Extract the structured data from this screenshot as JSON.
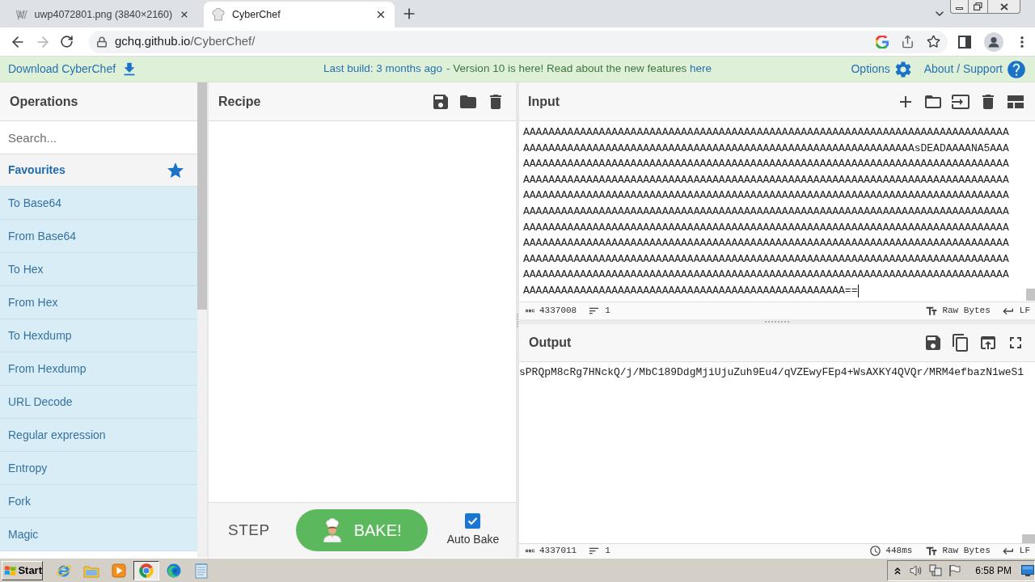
{
  "browser": {
    "tabs": [
      {
        "title": "uwp4072801.png (3840×2160)",
        "kind": "image",
        "selected": false
      },
      {
        "title": "CyberChef",
        "kind": "site",
        "selected": true
      }
    ],
    "url": {
      "host": "gchq.github.io",
      "path": "/CyberChef/"
    }
  },
  "banner": {
    "download": "Download CyberChef",
    "build": "Last build: 3 months ago",
    "notice": "- Version 10 is here! Read about the new features",
    "notice_link": "here",
    "options": "Options",
    "about": "About / Support"
  },
  "operations": {
    "title": "Operations",
    "search": {
      "placeholder": "Search..."
    },
    "favourites": "Favourites",
    "items": [
      "To Base64",
      "From Base64",
      "To Hex",
      "From Hex",
      "To Hexdump",
      "From Hexdump",
      "URL Decode",
      "Regular expression",
      "Entropy",
      "Fork",
      "Magic"
    ]
  },
  "recipe": {
    "title": "Recipe",
    "step": "STEP",
    "bake": "BAKE!",
    "auto_bake": {
      "label": "Auto Bake",
      "checked": true
    }
  },
  "input": {
    "title": "Input",
    "lines": [
      "AAAAAAAAAAAAAAAAAAAAAAAAAAAAAAAAAAAAAAAAAAAAAAAAAAAAAAAAAAAAAAAAAAAAAAAAAAAAA",
      "AAAAAAAAAAAAAAAAAAAAAAAAAAAAAAAAAAAAAAAAAAAAAAAAAAAAAAAAAAAAAAsDEADAAAANA5AAA",
      "AAAAAAAAAAAAAAAAAAAAAAAAAAAAAAAAAAAAAAAAAAAAAAAAAAAAAAAAAAAAAAAAAAAAAAAAAAAAA",
      "AAAAAAAAAAAAAAAAAAAAAAAAAAAAAAAAAAAAAAAAAAAAAAAAAAAAAAAAAAAAAAAAAAAAAAAAAAAAA",
      "AAAAAAAAAAAAAAAAAAAAAAAAAAAAAAAAAAAAAAAAAAAAAAAAAAAAAAAAAAAAAAAAAAAAAAAAAAAAA",
      "AAAAAAAAAAAAAAAAAAAAAAAAAAAAAAAAAAAAAAAAAAAAAAAAAAAAAAAAAAAAAAAAAAAAAAAAAAAAA",
      "AAAAAAAAAAAAAAAAAAAAAAAAAAAAAAAAAAAAAAAAAAAAAAAAAAAAAAAAAAAAAAAAAAAAAAAAAAAAA",
      "AAAAAAAAAAAAAAAAAAAAAAAAAAAAAAAAAAAAAAAAAAAAAAAAAAAAAAAAAAAAAAAAAAAAAAAAAAAAA",
      "AAAAAAAAAAAAAAAAAAAAAAAAAAAAAAAAAAAAAAAAAAAAAAAAAAAAAAAAAAAAAAAAAAAAAAAAAAAAA",
      "AAAAAAAAAAAAAAAAAAAAAAAAAAAAAAAAAAAAAAAAAAAAAAAAAAAAAAAAAAAAAAAAAAAAAAAAAAAAA",
      "AAAAAAAAAAAAAAAAAAAAAAAAAAAAAAAAAAAAAAAAAAAAAAAAAAA=="
    ],
    "status": {
      "length": "4337008",
      "lines": "1",
      "format": "Raw Bytes",
      "eol": "LF"
    }
  },
  "output": {
    "title": "Output",
    "lines": [
      "sPRQpM8cRg7HNckQ/j/MbC189DdgMjiUjuZuh9Eu4/qVZEwyFEp4+WsAXKY4QVQr/MRM4efbazN1weS1"
    ],
    "status": {
      "length": "4337011",
      "lines": "1",
      "time": "448ms",
      "format": "Raw Bytes",
      "eol": "LF"
    }
  },
  "taskbar": {
    "start": "Start",
    "apps": [
      {
        "kind": "ie",
        "selected": false
      },
      {
        "kind": "explorer",
        "selected": false
      },
      {
        "kind": "media",
        "selected": false
      },
      {
        "kind": "chrome",
        "selected": true
      },
      {
        "kind": "edge",
        "selected": false
      },
      {
        "kind": "notepad",
        "selected": false
      }
    ],
    "clock": "6:58 PM"
  }
}
